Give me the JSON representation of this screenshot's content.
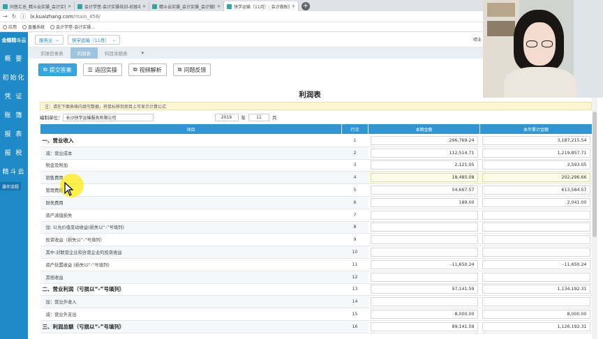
{
  "browser": {
    "tabs": [
      {
        "label": "问答汇总_精斗云实操_会计实操...",
        "active": false
      },
      {
        "label": "会计学堂-会计实操培训-初级中级...",
        "active": false
      },
      {
        "label": "精斗云实操_会计实操_会计做账...",
        "active": false
      },
      {
        "label": "快学运输（11月）: 会计做账实...",
        "active": true
      }
    ],
    "url_host": "lx.kuaizhang.com",
    "url_path": "/main_456/",
    "bookmarks": [
      "应用",
      "直播系统",
      "会计学堂-会计实操..."
    ]
  },
  "sidebar": {
    "logo": "金蝶精斗云",
    "items": [
      "概 要",
      "初始化",
      "凭 证",
      "账 簿",
      "报 表",
      "报 税",
      "精斗云"
    ],
    "button": "操作流程"
  },
  "topbar": {
    "industry": "服务业",
    "company": "快学运输（11月）",
    "user": "晴业"
  },
  "subtabs": [
    "实操目录表",
    "利润表",
    "科目余额表"
  ],
  "toolbar": {
    "submit": "提交答案",
    "back": "返回实操",
    "video": "视频解析",
    "feedback": "问题反馈"
  },
  "report": {
    "title": "利润表",
    "note": "注：请在下面表格内填写数据，将鼠标移到项目上可显示计算公式",
    "unit_label": "编制单位：",
    "unit": "长沙快学运输服务有限公司",
    "year": "2019",
    "year_label": "年",
    "month": "11",
    "month_label": "月",
    "headers": [
      "项目",
      "行次",
      "本期金额",
      "本年累计金额"
    ],
    "rows": [
      {
        "item": "一、营业收入",
        "idx": "1",
        "cur": "296,769.24",
        "ytd": "3,187,215.54",
        "bold": true
      },
      {
        "item": "减：营业成本",
        "idx": "2",
        "cur": "112,514.71",
        "ytd": "1,219,857.71"
      },
      {
        "item": "税金及附加",
        "idx": "3",
        "cur": "2,121.05",
        "ytd": "3,593.05"
      },
      {
        "item": "销售费用",
        "idx": "4",
        "cur": "18,485.08",
        "ytd": "202,296.66",
        "highlight": true
      },
      {
        "item": "管理费用",
        "idx": "5",
        "cur": "54,667.57",
        "ytd": "613,584.57"
      },
      {
        "item": "财务费用",
        "idx": "6",
        "cur": "189.00",
        "ytd": "2,041.00"
      },
      {
        "item": "资产减值损失",
        "idx": "7",
        "cur": "",
        "ytd": ""
      },
      {
        "item": "加: 公允价值变动收益(损失以“-”号填列)",
        "idx": "8",
        "cur": "",
        "ytd": ""
      },
      {
        "item": "投资收益（损失以“-”号填列）",
        "idx": "9",
        "cur": "",
        "ytd": ""
      },
      {
        "item": "其中:对联营企业和合营企业的投资收益",
        "idx": "10",
        "cur": "",
        "ytd": ""
      },
      {
        "item": "资产处置收益 (损失以“-”号填列)",
        "idx": "11",
        "cur": "-11,650.24",
        "ytd": "-11,650.24"
      },
      {
        "item": "其他收益",
        "idx": "12",
        "cur": "",
        "ytd": ""
      },
      {
        "item": "二、营业利润（亏损以“-”号填列）",
        "idx": "13",
        "cur": "97,141.59",
        "ytd": "1,134,192.31",
        "bold": true
      },
      {
        "item": "加：营业外收入",
        "idx": "14",
        "cur": "",
        "ytd": ""
      },
      {
        "item": "减：营业外支出",
        "idx": "15",
        "cur": "8,000.00",
        "ytd": "8,000.00"
      },
      {
        "item": "三、利润总额（亏损以“-”号填列）",
        "idx": "16",
        "cur": "89,141.59",
        "ytd": "1,126,192.31",
        "bold": true
      }
    ]
  },
  "colors": {
    "sidebar": "#1f8ac8",
    "header": "#2c97d4",
    "primary_button": "#38a5e0",
    "note_bg": "#fdf6d3"
  }
}
